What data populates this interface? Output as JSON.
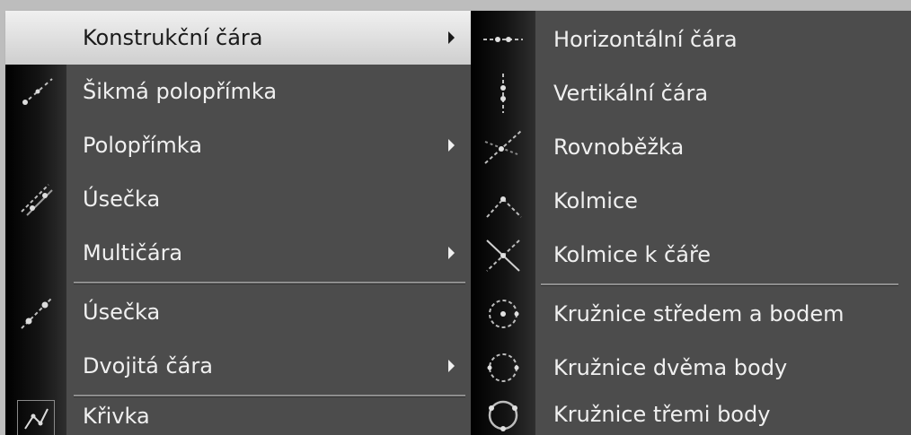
{
  "main_menu": {
    "items": [
      {
        "label": "Konstrukční čára",
        "icon": "construction-line-icon",
        "submenu": true,
        "highlighted": true
      },
      {
        "label": "Šikmá polopřímka",
        "icon": "ray-icon",
        "submenu": false
      },
      {
        "label": "Polopřímka",
        "icon": "",
        "submenu": true
      },
      {
        "label": "Úsečka",
        "icon": "line-segment-icon",
        "submenu": false
      },
      {
        "label": "Multičára",
        "icon": "",
        "submenu": true
      },
      {
        "label": "Úsečka",
        "icon": "line-segment-icon",
        "submenu": false
      },
      {
        "label": "Dvojitá čára",
        "icon": "",
        "submenu": true
      },
      {
        "label": "Křivka",
        "icon": "curve-icon",
        "submenu": false
      }
    ]
  },
  "sub_menu": {
    "items": [
      {
        "label": "Horizontální čára",
        "icon": "horizontal-line-icon"
      },
      {
        "label": "Vertikální čára",
        "icon": "vertical-line-icon"
      },
      {
        "label": "Rovnoběžka",
        "icon": "parallel-line-icon"
      },
      {
        "label": "Kolmice",
        "icon": "perpendicular-icon"
      },
      {
        "label": "Kolmice k čáře",
        "icon": "perpendicular-to-line-icon"
      },
      {
        "label": "Kružnice středem a bodem",
        "icon": "circle-center-point-icon"
      },
      {
        "label": "Kružnice dvěma body",
        "icon": "circle-two-points-icon"
      },
      {
        "label": "Kružnice třemi body",
        "icon": "circle-three-points-icon"
      }
    ]
  },
  "colors": {
    "menu_bg": "#4c4c4c",
    "text": "#f0f0f0",
    "highlight_bg": "#e8e8e8",
    "highlight_text": "#1a1a1a",
    "separator": "#8e8e8e"
  }
}
